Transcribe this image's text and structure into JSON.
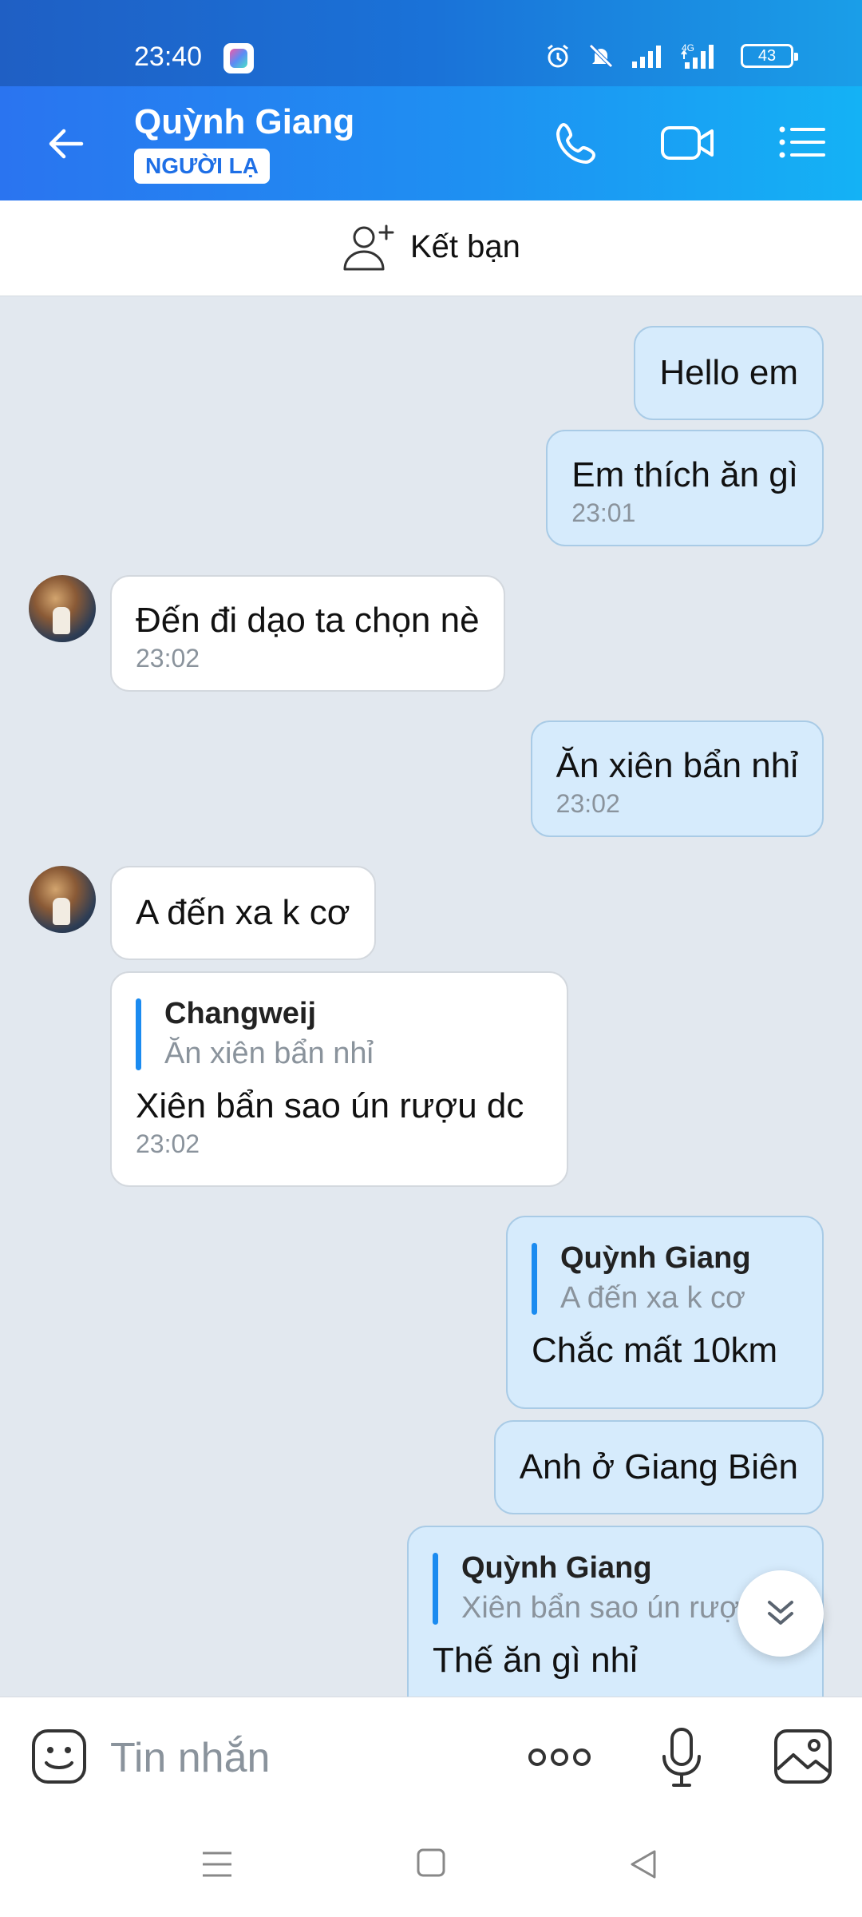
{
  "status_bar": {
    "time": "23:40",
    "battery": "43",
    "network": "4G"
  },
  "header": {
    "contact_name": "Quỳnh Giang",
    "badge": "NGƯỜI LẠ"
  },
  "add_friend": {
    "label": "Kết bạn"
  },
  "messages": [
    {
      "direction": "out",
      "text": "Hello em"
    },
    {
      "direction": "out",
      "text": "Em thích ăn gì",
      "time": "23:01"
    },
    {
      "direction": "in",
      "text": "Đến đi dạo ta chọn nè",
      "time": "23:02"
    },
    {
      "direction": "out",
      "text": "Ăn xiên bẩn nhỉ",
      "time": "23:02"
    },
    {
      "direction": "in",
      "text": "A đến xa k cơ"
    },
    {
      "direction": "in",
      "quote_author": "Changweij",
      "quote_text": "Ăn xiên bẩn nhỉ",
      "text": "Xiên bẩn sao ún rượu dc",
      "time": "23:02"
    },
    {
      "direction": "out",
      "quote_author": "Quỳnh Giang",
      "quote_text": "A đến xa k cơ",
      "text": "Chắc mất 10km"
    },
    {
      "direction": "out",
      "text": "Anh ở Giang Biên"
    },
    {
      "direction": "out",
      "quote_author": "Quỳnh Giang",
      "quote_text": "Xiên bẩn sao ún rượu dc",
      "text": "Thế ăn gì nhỉ"
    }
  ],
  "input": {
    "placeholder": "Tin nhắn"
  },
  "colors": {
    "header_start": "#2a74f0",
    "header_end": "#14b2f5",
    "outgoing_bubble": "#d6ebfc",
    "incoming_bubble": "#ffffff",
    "accent": "#1b8bf0"
  },
  "icons": [
    "back-arrow-icon",
    "phone-icon",
    "video-icon",
    "list-menu-icon",
    "add-person-icon",
    "emoji-icon",
    "more-dots-icon",
    "microphone-icon",
    "image-icon",
    "chevron-double-down-icon"
  ]
}
